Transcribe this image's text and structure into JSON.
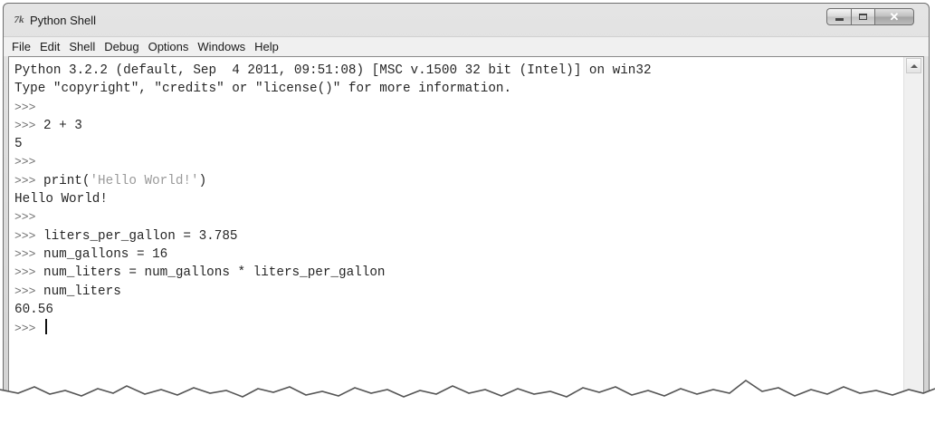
{
  "window": {
    "title": "Python Shell",
    "app_icon": "7k",
    "controls": {
      "minimize": "minimize-icon",
      "maximize": "maximize-icon",
      "close": "✕"
    }
  },
  "menu": {
    "items": [
      "File",
      "Edit",
      "Shell",
      "Debug",
      "Options",
      "Windows",
      "Help"
    ]
  },
  "shell": {
    "banner": [
      "Python 3.2.2 (default, Sep  4 2011, 09:51:08) [MSC v.1500 32 bit (Intel)] on win32",
      "Type \"copyright\", \"credits\" or \"license()\" for more information."
    ],
    "prompt": ">>>",
    "session": [
      {
        "prompt": true,
        "text": ""
      },
      {
        "prompt": true,
        "text": " 2 + 3"
      },
      {
        "prompt": false,
        "text": "5"
      },
      {
        "prompt": true,
        "text": ""
      },
      {
        "prompt": true,
        "pre": " print(",
        "str": "'Hello World!'",
        "post": ")"
      },
      {
        "prompt": false,
        "text": "Hello World!"
      },
      {
        "prompt": true,
        "text": ""
      },
      {
        "prompt": true,
        "text": " liters_per_gallon = 3.785"
      },
      {
        "prompt": true,
        "text": " num_gallons = 16"
      },
      {
        "prompt": true,
        "text": " num_liters = num_gallons * liters_per_gallon"
      },
      {
        "prompt": true,
        "text": " num_liters"
      },
      {
        "prompt": false,
        "text": "60.56"
      },
      {
        "prompt": true,
        "text": " ",
        "cursor": true
      }
    ]
  },
  "scrollbar": {
    "up_icon": "scroll-up-arrow-icon"
  }
}
